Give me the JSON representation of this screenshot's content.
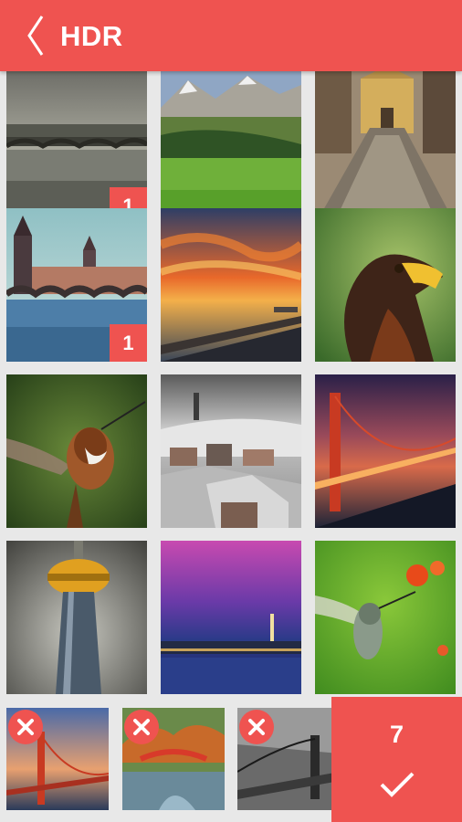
{
  "header": {
    "title": "HDR"
  },
  "photos": [
    {
      "name": "bridge-river",
      "badge": "1"
    },
    {
      "name": "mountain-valley",
      "badge": ""
    },
    {
      "name": "village-street",
      "badge": ""
    },
    {
      "name": "prague-bridge",
      "badge": "1"
    },
    {
      "name": "sunset-pier",
      "badge": ""
    },
    {
      "name": "eagle",
      "badge": ""
    },
    {
      "name": "hummingbird",
      "badge": ""
    },
    {
      "name": "snowy-village",
      "badge": ""
    },
    {
      "name": "golden-gate-fog",
      "badge": ""
    },
    {
      "name": "tv-tower",
      "badge": ""
    },
    {
      "name": "city-night",
      "badge": ""
    },
    {
      "name": "hummingbird-flowers",
      "badge": ""
    }
  ],
  "selected": [
    {
      "name": "golden-gate"
    },
    {
      "name": "red-bridge-autumn"
    },
    {
      "name": "suspension-bridge-bw"
    }
  ],
  "confirm": {
    "count": "7"
  },
  "colors": {
    "accent": "#ef5350"
  }
}
